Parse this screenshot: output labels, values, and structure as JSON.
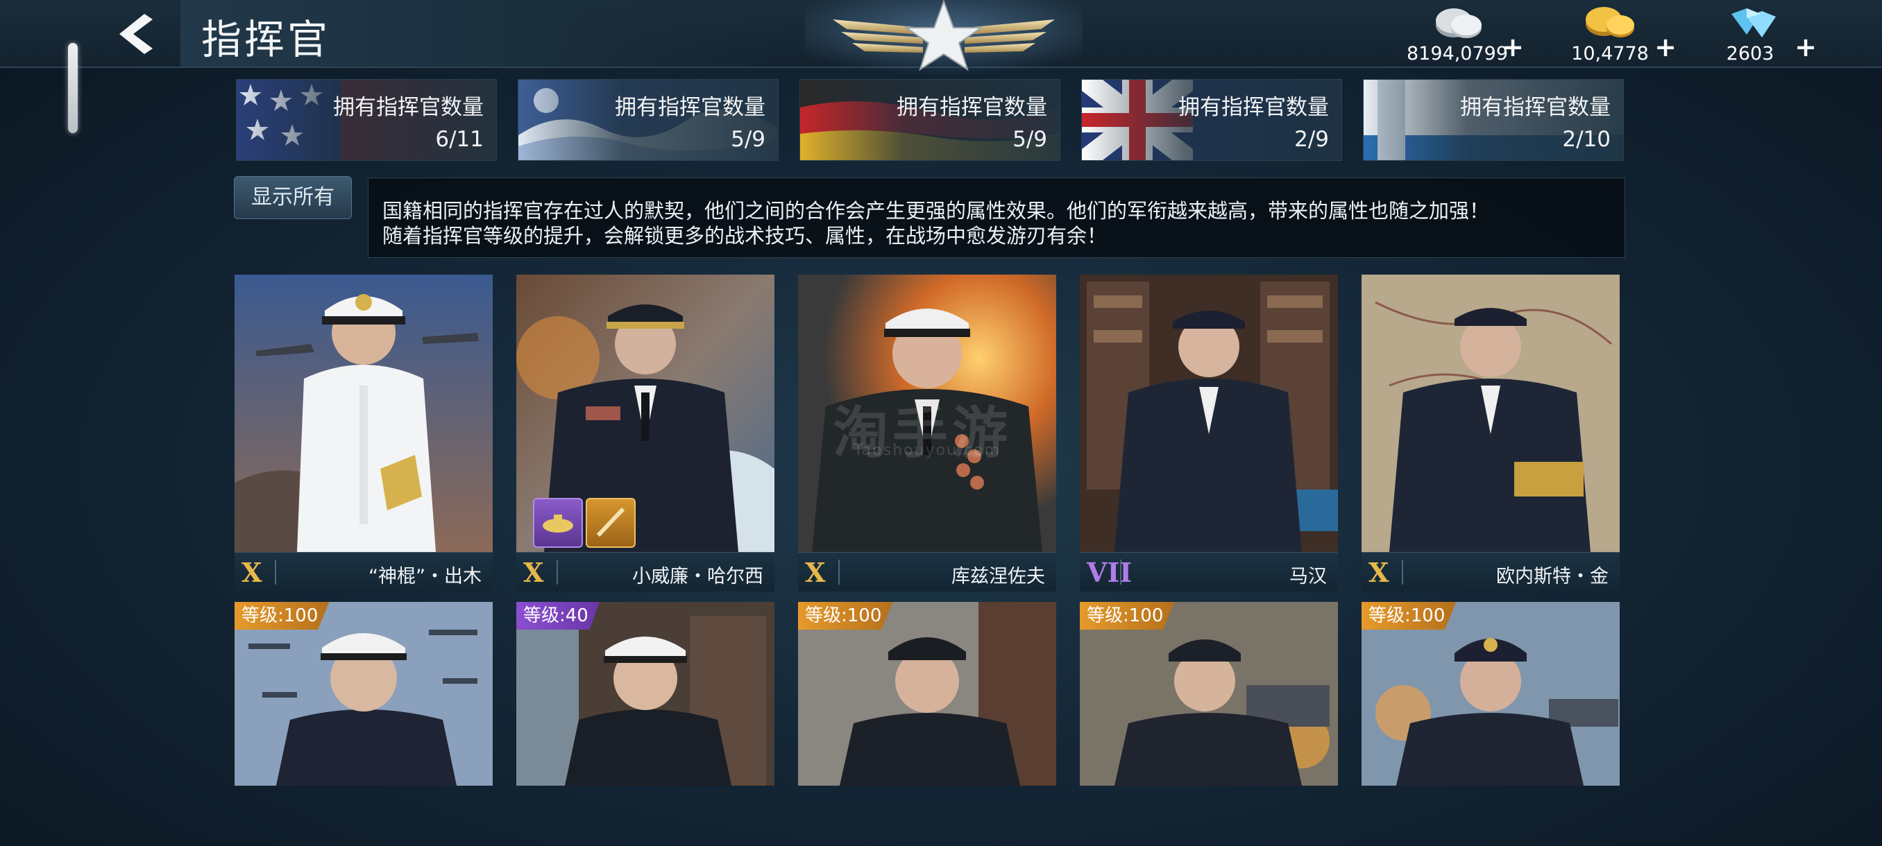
{
  "header": {
    "title": "指挥官",
    "currencies": [
      {
        "icon": "silver-coin-icon",
        "value": "8194,0799",
        "plus": "+"
      },
      {
        "icon": "gold-coin-icon",
        "value": "10,4778",
        "plus": "+"
      },
      {
        "icon": "diamond-icon",
        "value": "2603",
        "plus": "+"
      }
    ]
  },
  "nations": [
    {
      "flag": "usa",
      "label": "拥有指挥官数量",
      "count": "6/11"
    },
    {
      "flag": "japan",
      "label": "拥有指挥官数量",
      "count": "5/9"
    },
    {
      "flag": "germany",
      "label": "拥有指挥官数量",
      "count": "5/9"
    },
    {
      "flag": "uk",
      "label": "拥有指挥官数量",
      "count": "2/9"
    },
    {
      "flag": "ussr",
      "label": "拥有指挥官数量",
      "count": "2/10"
    }
  ],
  "show_all_label": "显示所有",
  "description": [
    "国籍相同的指挥官存在过人的默契，他们之间的合作会产生更强的属性效果。他们的军衔越来越高，带来的属性也随之加强！",
    "随着指挥官等级的提升，会解锁更多的战术技巧、属性，在战场中愈发游刃有余！"
  ],
  "commanders_row1": [
    {
      "rank": "X",
      "rank_color": "gold",
      "name": "“神棍”・出木",
      "uniform": "white"
    },
    {
      "rank": "X",
      "rank_color": "gold",
      "name": "小威廉・哈尔西",
      "uniform": "navy"
    },
    {
      "rank": "X",
      "rank_color": "gold",
      "name": "库兹涅佐夫",
      "uniform": "dark"
    },
    {
      "rank": "VII",
      "rank_color": "purple",
      "name": "马汉",
      "uniform": "navy"
    },
    {
      "rank": "X",
      "rank_color": "gold",
      "name": "欧内斯特・金",
      "uniform": "navy"
    }
  ],
  "skills": [
    {
      "icon": "submarine-skill-icon"
    },
    {
      "icon": "torpedo-skill-icon"
    }
  ],
  "commanders_row2": [
    {
      "level": "等级:100",
      "level_color": "gold"
    },
    {
      "level": "等级:40",
      "level_color": "purple"
    },
    {
      "level": "等级:100",
      "level_color": "gold"
    },
    {
      "level": "等级:100",
      "level_color": "gold"
    },
    {
      "level": "等级:100",
      "level_color": "gold"
    }
  ],
  "watermark": {
    "text": "淘手游",
    "sub": "Taoshouyou.com"
  }
}
